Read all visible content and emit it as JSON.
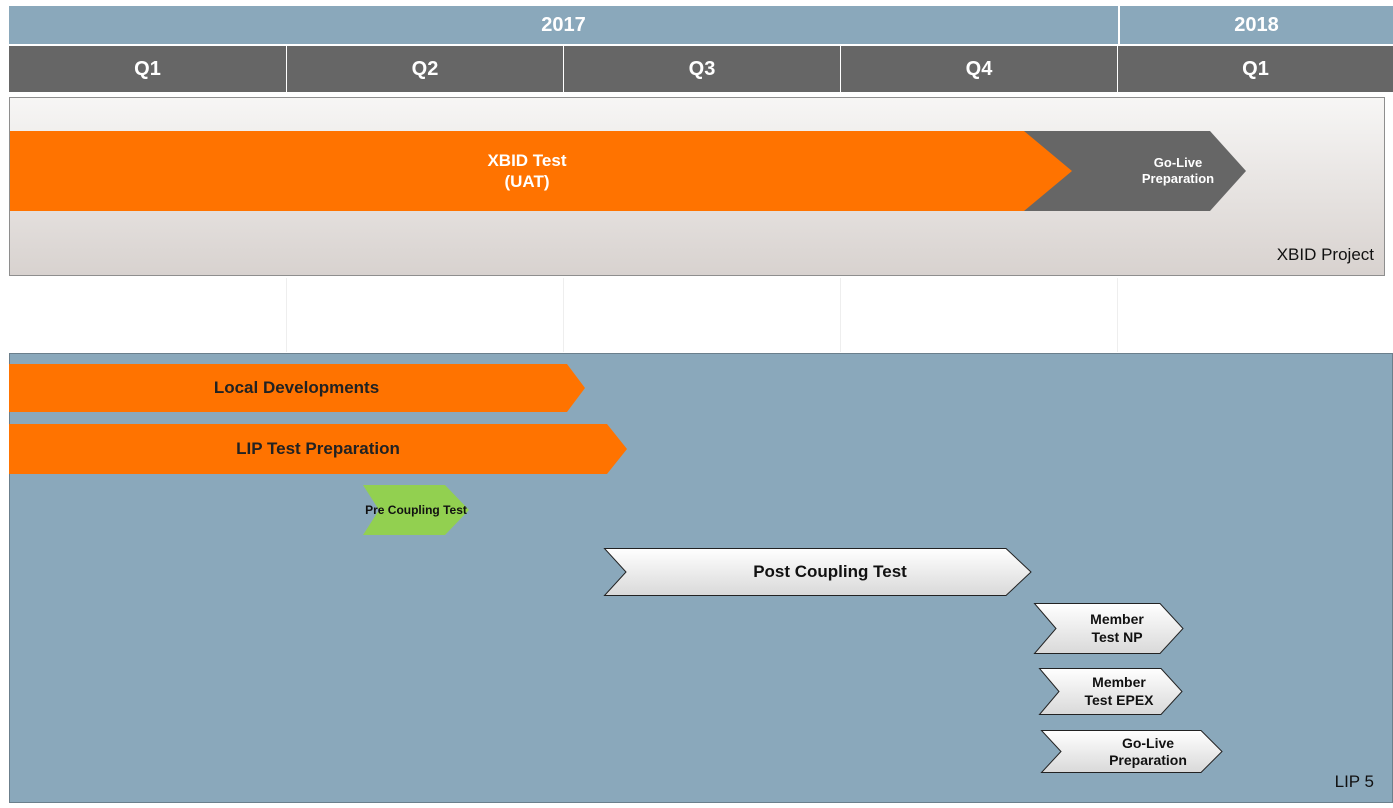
{
  "header": {
    "years": [
      {
        "label": "2017"
      },
      {
        "label": "2018"
      }
    ],
    "quarters": [
      {
        "label": "Q1"
      },
      {
        "label": "Q2"
      },
      {
        "label": "Q3"
      },
      {
        "label": "Q4"
      },
      {
        "label": "Q1"
      }
    ]
  },
  "colors": {
    "orange": "#ff7300",
    "dark_gray": "#666666",
    "steel_blue": "#8aa8bb",
    "light_gray_arrow": "#e6e6e6",
    "green": "#92d050"
  },
  "xbid_panel": {
    "label": "XBID Project",
    "bars": [
      {
        "line1": "XBID Test",
        "line2": "(UAT)"
      },
      {
        "line1": "Go-Live",
        "line2": "Preparation"
      }
    ]
  },
  "lip_panel": {
    "label": "LIP 5",
    "bars": [
      {
        "text": "Local Developments"
      },
      {
        "text": "LIP Test Preparation"
      },
      {
        "text": "Pre Coupling Test"
      },
      {
        "text": "Post Coupling Test"
      },
      {
        "line1": "Member",
        "line2": "Test NP"
      },
      {
        "line1": "Member",
        "line2": "Test EPEX"
      },
      {
        "line1": "Go-Live",
        "line2": "Preparation"
      }
    ]
  }
}
